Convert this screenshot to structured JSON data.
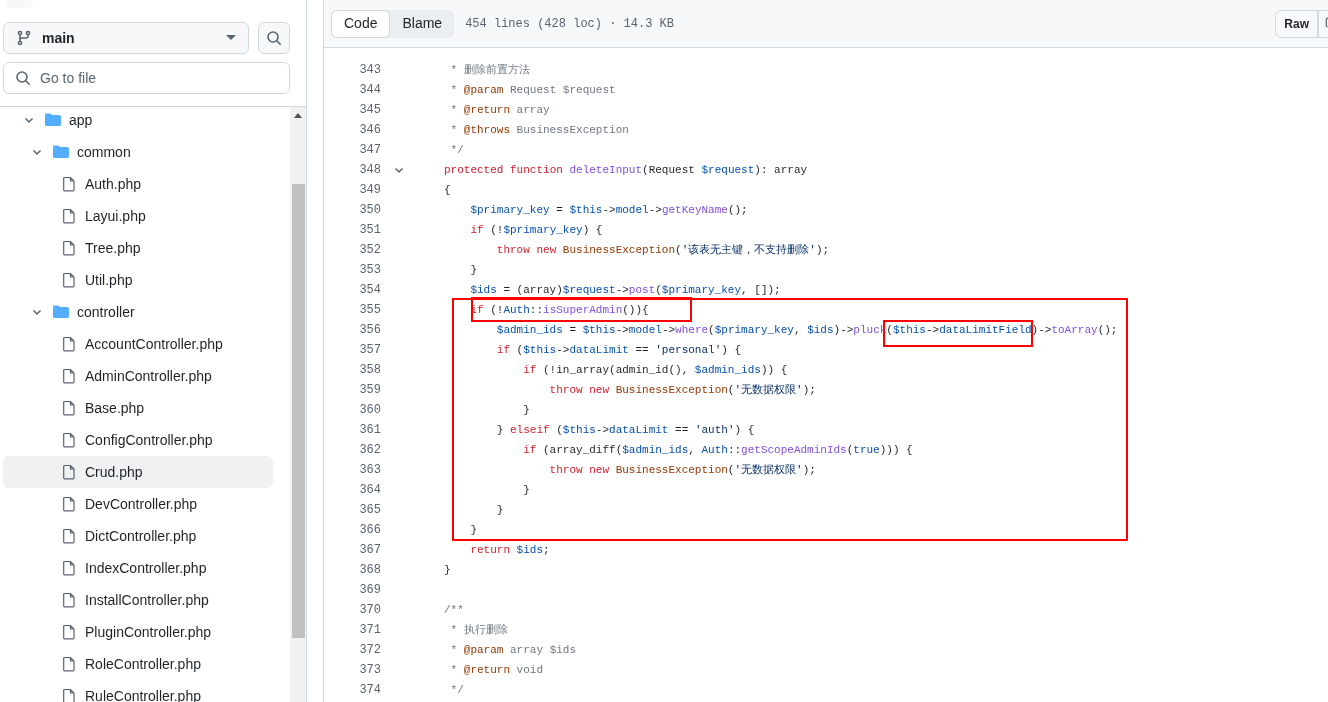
{
  "sidebar": {
    "branch": "main",
    "go_to_file": {
      "placeholder": "Go to file"
    },
    "tree": [
      {
        "kind": "folder",
        "name": "app",
        "expanded": true,
        "selected": false,
        "children": [
          {
            "kind": "folder",
            "name": "common",
            "expanded": true,
            "selected": false,
            "children": [
              {
                "kind": "file",
                "name": "Auth.php",
                "selected": false
              },
              {
                "kind": "file",
                "name": "Layui.php",
                "selected": false
              },
              {
                "kind": "file",
                "name": "Tree.php",
                "selected": false
              },
              {
                "kind": "file",
                "name": "Util.php",
                "selected": false
              }
            ]
          },
          {
            "kind": "folder",
            "name": "controller",
            "expanded": true,
            "selected": false,
            "children": [
              {
                "kind": "file",
                "name": "AccountController.php",
                "selected": false
              },
              {
                "kind": "file",
                "name": "AdminController.php",
                "selected": false
              },
              {
                "kind": "file",
                "name": "Base.php",
                "selected": false
              },
              {
                "kind": "file",
                "name": "ConfigController.php",
                "selected": false
              },
              {
                "kind": "file",
                "name": "Crud.php",
                "selected": true
              },
              {
                "kind": "file",
                "name": "DevController.php",
                "selected": false
              },
              {
                "kind": "file",
                "name": "DictController.php",
                "selected": false
              },
              {
                "kind": "file",
                "name": "IndexController.php",
                "selected": false
              },
              {
                "kind": "file",
                "name": "InstallController.php",
                "selected": false
              },
              {
                "kind": "file",
                "name": "PluginController.php",
                "selected": false
              },
              {
                "kind": "file",
                "name": "RoleController.php",
                "selected": false
              },
              {
                "kind": "file",
                "name": "RuleController.php",
                "selected": false
              }
            ]
          }
        ]
      }
    ]
  },
  "file_header": {
    "tabs": [
      {
        "label": "Code",
        "selected": true
      },
      {
        "label": "Blame",
        "selected": false
      }
    ],
    "info": "454 lines (428 loc) · 14.3 KB",
    "raw_button": "Raw"
  },
  "code": [
    {
      "number": "343",
      "foldable": false,
      "tokens": [
        {
          "kind": "comment",
          "text": " * 删除前置方法"
        }
      ]
    },
    {
      "number": "344",
      "foldable": false,
      "tokens": [
        {
          "kind": "comment",
          "text": " *"
        },
        {
          "kind": "doctag",
          "text": " @param"
        },
        {
          "kind": "comment",
          "text": " Request $request"
        }
      ]
    },
    {
      "number": "345",
      "foldable": false,
      "tokens": [
        {
          "kind": "comment",
          "text": " *"
        },
        {
          "kind": "doctag",
          "text": " @return"
        },
        {
          "kind": "comment",
          "text": " array"
        }
      ]
    },
    {
      "number": "346",
      "foldable": false,
      "tokens": [
        {
          "kind": "comment",
          "text": " *"
        },
        {
          "kind": "doctag",
          "text": " @throws"
        },
        {
          "kind": "comment",
          "text": " BusinessException"
        }
      ]
    },
    {
      "number": "347",
      "foldable": false,
      "tokens": [
        {
          "kind": "comment",
          "text": " */"
        }
      ]
    },
    {
      "number": "348",
      "foldable": true,
      "tokens": [
        {
          "kind": "keyword",
          "text": "protected"
        },
        {
          "kind": "keyword",
          "text": " function"
        },
        {
          "kind": "method",
          "text": " deleteInput"
        },
        {
          "kind": "plain",
          "text": "(Request "
        },
        {
          "kind": "variable",
          "text": "$request"
        },
        {
          "kind": "plain",
          "text": "): array"
        }
      ]
    },
    {
      "number": "349",
      "foldable": false,
      "tokens": [
        {
          "kind": "plain",
          "text": "{"
        }
      ]
    },
    {
      "number": "350",
      "foldable": false,
      "tokens": [
        {
          "kind": "variable",
          "text": "    $primary_key"
        },
        {
          "kind": "plain",
          "text": " = "
        },
        {
          "kind": "variable",
          "text": "$this"
        },
        {
          "kind": "plain",
          "text": "->"
        },
        {
          "kind": "variable",
          "text": "model"
        },
        {
          "kind": "plain",
          "text": "->"
        },
        {
          "kind": "method",
          "text": "getKeyName"
        },
        {
          "kind": "plain",
          "text": "();"
        }
      ]
    },
    {
      "number": "351",
      "foldable": false,
      "tokens": [
        {
          "kind": "keyword",
          "text": "    if"
        },
        {
          "kind": "plain",
          "text": " (!"
        },
        {
          "kind": "variable",
          "text": "$primary_key"
        },
        {
          "kind": "plain",
          "text": ") {"
        }
      ]
    },
    {
      "number": "352",
      "foldable": false,
      "tokens": [
        {
          "kind": "keyword",
          "text": "        throw"
        },
        {
          "kind": "keyword",
          "text": " new"
        },
        {
          "kind": "class",
          "text": " BusinessException"
        },
        {
          "kind": "plain",
          "text": "("
        },
        {
          "kind": "string",
          "text": "'该表无主键，不支持删除'"
        },
        {
          "kind": "plain",
          "text": ");"
        }
      ]
    },
    {
      "number": "353",
      "foldable": false,
      "tokens": [
        {
          "kind": "plain",
          "text": "    }"
        }
      ]
    },
    {
      "number": "354",
      "foldable": false,
      "tokens": [
        {
          "kind": "variable",
          "text": "    $ids"
        },
        {
          "kind": "plain",
          "text": " = (array)"
        },
        {
          "kind": "variable",
          "text": "$request"
        },
        {
          "kind": "plain",
          "text": "->"
        },
        {
          "kind": "method",
          "text": "post"
        },
        {
          "kind": "plain",
          "text": "("
        },
        {
          "kind": "variable",
          "text": "$primary_key"
        },
        {
          "kind": "plain",
          "text": ", []);"
        }
      ]
    },
    {
      "number": "355",
      "foldable": false,
      "tokens": [
        {
          "kind": "keyword",
          "text": "    if"
        },
        {
          "kind": "plain",
          "text": " (!"
        },
        {
          "kind": "variable",
          "text": "Auth"
        },
        {
          "kind": "plain",
          "text": "::"
        },
        {
          "kind": "method",
          "text": "isSuperAdmin"
        },
        {
          "kind": "plain",
          "text": "()){"
        }
      ]
    },
    {
      "number": "356",
      "foldable": false,
      "tokens": [
        {
          "kind": "variable",
          "text": "        $admin_ids"
        },
        {
          "kind": "plain",
          "text": " = "
        },
        {
          "kind": "variable",
          "text": "$this"
        },
        {
          "kind": "plain",
          "text": "->"
        },
        {
          "kind": "variable",
          "text": "model"
        },
        {
          "kind": "plain",
          "text": "->"
        },
        {
          "kind": "method",
          "text": "where"
        },
        {
          "kind": "plain",
          "text": "("
        },
        {
          "kind": "variable",
          "text": "$primary_key"
        },
        {
          "kind": "plain",
          "text": ", "
        },
        {
          "kind": "variable",
          "text": "$ids"
        },
        {
          "kind": "plain",
          "text": ")->"
        },
        {
          "kind": "method",
          "text": "pluck"
        },
        {
          "kind": "plain",
          "text": "("
        },
        {
          "kind": "variable",
          "text": "$this"
        },
        {
          "kind": "plain",
          "text": "->"
        },
        {
          "kind": "variable",
          "text": "dataLimitField"
        },
        {
          "kind": "plain",
          "text": ")->"
        },
        {
          "kind": "method",
          "text": "toArray"
        },
        {
          "kind": "plain",
          "text": "();"
        }
      ]
    },
    {
      "number": "357",
      "foldable": false,
      "tokens": [
        {
          "kind": "keyword",
          "text": "        if"
        },
        {
          "kind": "plain",
          "text": " ("
        },
        {
          "kind": "variable",
          "text": "$this"
        },
        {
          "kind": "plain",
          "text": "->"
        },
        {
          "kind": "variable",
          "text": "dataLimit"
        },
        {
          "kind": "plain",
          "text": " == "
        },
        {
          "kind": "string",
          "text": "'personal'"
        },
        {
          "kind": "plain",
          "text": ") {"
        }
      ]
    },
    {
      "number": "358",
      "foldable": false,
      "tokens": [
        {
          "kind": "keyword",
          "text": "            if"
        },
        {
          "kind": "plain",
          "text": " (!in_array(admin_id(), "
        },
        {
          "kind": "variable",
          "text": "$admin_ids"
        },
        {
          "kind": "plain",
          "text": ")) {"
        }
      ]
    },
    {
      "number": "359",
      "foldable": false,
      "tokens": [
        {
          "kind": "keyword",
          "text": "                throw"
        },
        {
          "kind": "keyword",
          "text": " new"
        },
        {
          "kind": "class",
          "text": " BusinessException"
        },
        {
          "kind": "plain",
          "text": "("
        },
        {
          "kind": "string",
          "text": "'无数据权限'"
        },
        {
          "kind": "plain",
          "text": ");"
        }
      ]
    },
    {
      "number": "360",
      "foldable": false,
      "tokens": [
        {
          "kind": "plain",
          "text": "            }"
        }
      ]
    },
    {
      "number": "361",
      "foldable": false,
      "tokens": [
        {
          "kind": "plain",
          "text": "        }"
        },
        {
          "kind": "keyword",
          "text": " elseif"
        },
        {
          "kind": "plain",
          "text": " ("
        },
        {
          "kind": "variable",
          "text": "$this"
        },
        {
          "kind": "plain",
          "text": "->"
        },
        {
          "kind": "variable",
          "text": "dataLimit"
        },
        {
          "kind": "plain",
          "text": " == "
        },
        {
          "kind": "string",
          "text": "'auth'"
        },
        {
          "kind": "plain",
          "text": ") {"
        }
      ]
    },
    {
      "number": "362",
      "foldable": false,
      "tokens": [
        {
          "kind": "keyword",
          "text": "            if"
        },
        {
          "kind": "plain",
          "text": " (array_diff("
        },
        {
          "kind": "variable",
          "text": "$admin_ids"
        },
        {
          "kind": "plain",
          "text": ", "
        },
        {
          "kind": "variable",
          "text": "Auth"
        },
        {
          "kind": "plain",
          "text": "::"
        },
        {
          "kind": "method",
          "text": "getScopeAdminIds"
        },
        {
          "kind": "plain",
          "text": "("
        },
        {
          "kind": "variable",
          "text": "true"
        },
        {
          "kind": "plain",
          "text": "))) {"
        }
      ]
    },
    {
      "number": "363",
      "foldable": false,
      "tokens": [
        {
          "kind": "keyword",
          "text": "                throw"
        },
        {
          "kind": "keyword",
          "text": " new"
        },
        {
          "kind": "class",
          "text": " BusinessException"
        },
        {
          "kind": "plain",
          "text": "("
        },
        {
          "kind": "string",
          "text": "'无数据权限'"
        },
        {
          "kind": "plain",
          "text": ");"
        }
      ]
    },
    {
      "number": "364",
      "foldable": false,
      "tokens": [
        {
          "kind": "plain",
          "text": "            }"
        }
      ]
    },
    {
      "number": "365",
      "foldable": false,
      "tokens": [
        {
          "kind": "plain",
          "text": "        }"
        }
      ]
    },
    {
      "number": "366",
      "foldable": false,
      "tokens": [
        {
          "kind": "plain",
          "text": "    }"
        }
      ]
    },
    {
      "number": "367",
      "foldable": false,
      "tokens": [
        {
          "kind": "keyword",
          "text": "    return"
        },
        {
          "kind": "variable",
          "text": " $ids"
        },
        {
          "kind": "plain",
          "text": ";"
        }
      ]
    },
    {
      "number": "368",
      "foldable": false,
      "tokens": [
        {
          "kind": "plain",
          "text": "}"
        }
      ]
    },
    {
      "number": "369",
      "foldable": false
    },
    {
      "number": "370",
      "foldable": false,
      "tokens": [
        {
          "kind": "comment",
          "text": "/**"
        }
      ]
    },
    {
      "number": "371",
      "foldable": false,
      "tokens": [
        {
          "kind": "comment",
          "text": " * 执行删除"
        }
      ]
    },
    {
      "number": "372",
      "foldable": false,
      "tokens": [
        {
          "kind": "comment",
          "text": " *"
        },
        {
          "kind": "doctag",
          "text": " @param"
        },
        {
          "kind": "comment",
          "text": " array $ids"
        }
      ]
    },
    {
      "number": "373",
      "foldable": false,
      "tokens": [
        {
          "kind": "comment",
          "text": " *"
        },
        {
          "kind": "doctag",
          "text": " @return"
        },
        {
          "kind": "comment",
          "text": " void"
        }
      ]
    },
    {
      "number": "374",
      "foldable": false,
      "tokens": [
        {
          "kind": "comment",
          "text": " */"
        }
      ]
    }
  ]
}
